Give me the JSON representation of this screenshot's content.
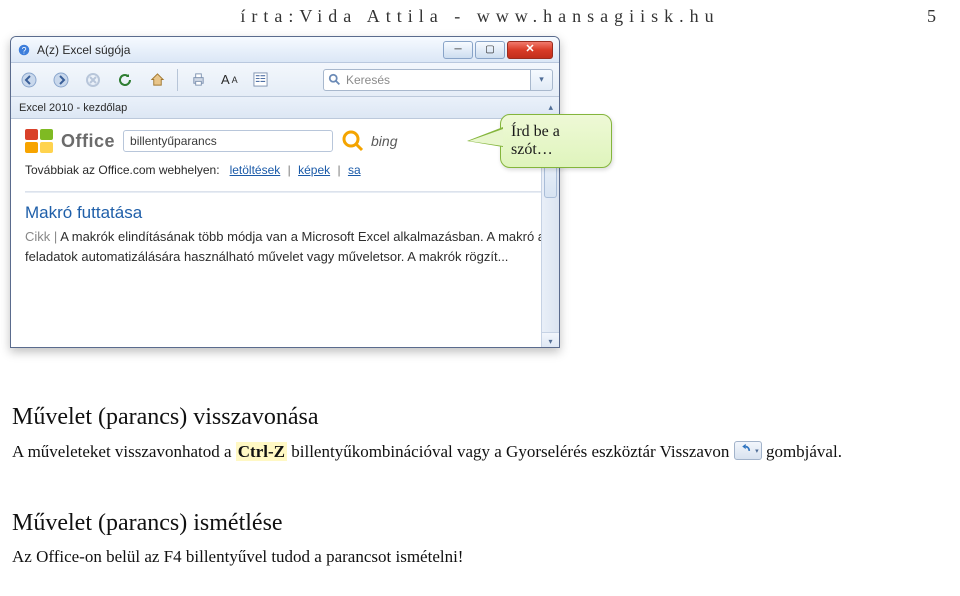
{
  "header": {
    "author_line": "írta:Vida Attila - www.hansagiisk.hu",
    "page_number": "5"
  },
  "help_window": {
    "title": "A(z) Excel súgója",
    "toolbar": {
      "search_placeholder": "Keresés"
    },
    "breadcrumb": "Excel 2010 - kezdőlap",
    "office": {
      "brand": "Office",
      "search_value": "billentyűparancs",
      "search_engine": "bing"
    },
    "more_row": {
      "prefix": "Továbbiak az Office.com webhelyen:",
      "link1": "letöltések",
      "link2": "képek",
      "link3": "sa"
    },
    "article": {
      "title": "Makró futtatása",
      "body_label": "Cikk",
      "body": "A makrók elindításának több módja van a Microsoft Excel alkalmazásban. A makró a feladatok automatizálására használható művelet vagy műveletsor. A makrók rögzít..."
    }
  },
  "callout": {
    "line1": "Írd be a",
    "line2": "szót…"
  },
  "doc": {
    "h_undo": "Művelet (parancs) visszavonása",
    "p_undo_1": "A műveleteket visszavonhatod a ",
    "p_undo_key": "Ctrl-Z",
    "p_undo_2": " billentyűkombinációval vagy a Gyorselérés eszköztár Visszavon ",
    "p_undo_3": " gombjával.",
    "h_redo": "Művelet (parancs) ismétlése",
    "p_redo": "Az Office-on belül az F4 billentyűvel tudod a parancsot ismételni!"
  }
}
